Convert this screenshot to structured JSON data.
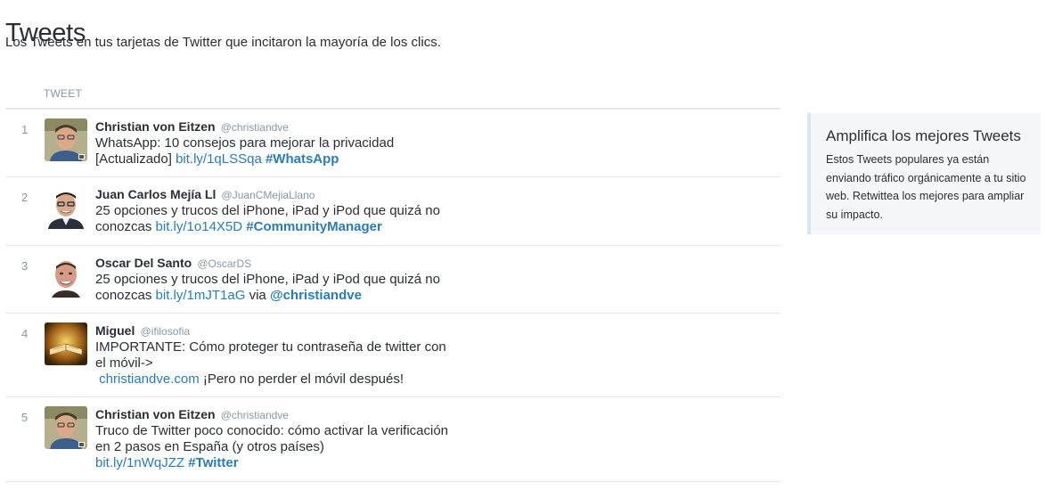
{
  "header": {
    "title": "Tweets",
    "subtitle": "Los Tweets en tus tarjetas de Twitter que incitaron la mayoría de los clics."
  },
  "table": {
    "column_header": "TWEET",
    "rows": [
      {
        "rank": "1",
        "name": "Christian von Eitzen",
        "handle": "@christiandve",
        "avatar": "person-glasses-avatar",
        "text": "WhatsApp: 10 consejos para mejorar la privacidad [Actualizado]",
        "link": "bit.ly/1qLSSqa",
        "hashtag": "#WhatsApp"
      },
      {
        "rank": "2",
        "name": "Juan Carlos Mejía Ll",
        "handle": "@JuanCMejiaLlano",
        "avatar": "person-smiling-avatar",
        "text": "25 opciones y trucos del iPhone, iPad y iPod que quizá no conozcas",
        "link": "bit.ly/1o14X5D",
        "hashtag": "#CommunityManager"
      },
      {
        "rank": "3",
        "name": "Oscar Del Santo",
        "handle": "@OscarDS",
        "avatar": "person-bald-avatar",
        "text": "25 opciones y trucos del iPhone, iPad y iPod que quizá no conozcas",
        "link": "bit.ly/1mJT1aG",
        "via": "via",
        "mention": "@christiandve"
      },
      {
        "rank": "4",
        "name": "Miguel",
        "handle": "@ifilosofia",
        "avatar": "open-book-avatar",
        "text": "IMPORTANTE: Cómo proteger tu contraseña de twitter con el móvil->",
        "link": "christiandve.com",
        "text_after": "¡Pero no perder el móvil después!"
      },
      {
        "rank": "5",
        "name": "Christian von Eitzen",
        "handle": "@christiandve",
        "avatar": "person-glasses-avatar",
        "text": "Truco de Twitter poco conocido: cómo activar la verificación en 2 pasos en España (y otros países)",
        "link": "bit.ly/1nWqJZZ",
        "hashtag": "#Twitter"
      }
    ]
  },
  "promo": {
    "title": "Amplifica los mejores Tweets",
    "text": "Estos Tweets populares ya están enviando tráfico orgánicamente a tu sitio web. Retwittea los mejores para ampliar su impacto."
  },
  "colors": {
    "link": "#2b7bb9",
    "muted": "#8899a6",
    "divider": "#e1e8ed",
    "promo_bg": "#f5f8fa",
    "promo_border": "#d6e7f5"
  }
}
